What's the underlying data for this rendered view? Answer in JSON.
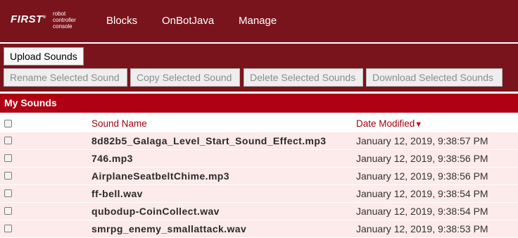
{
  "nav": {
    "logo_first": "FIRST",
    "logo_line1": "robot",
    "logo_line2": "controller",
    "logo_line3": "console",
    "items": [
      "Blocks",
      "OnBotJava",
      "Manage"
    ]
  },
  "actions": {
    "upload": "Upload Sounds",
    "rename": "Rename Selected Sound",
    "copy": "Copy Selected Sound",
    "delete": "Delete Selected Sounds",
    "download": "Download Selected Sounds"
  },
  "section_title": "My Sounds",
  "table": {
    "headers": {
      "name": "Sound Name",
      "date": "Date Modified",
      "sort_indicator": "▼"
    },
    "rows": [
      {
        "name": "8d82b5_Galaga_Level_Start_Sound_Effect.mp3",
        "date": "January 12, 2019, 9:38:57 PM"
      },
      {
        "name": "746.mp3",
        "date": "January 12, 2019, 9:38:56 PM"
      },
      {
        "name": "AirplaneSeatbeltChime.mp3",
        "date": "January 12, 2019, 9:38:56 PM"
      },
      {
        "name": "ff-bell.wav",
        "date": "January 12, 2019, 9:38:54 PM"
      },
      {
        "name": "qubodup-CoinCollect.wav",
        "date": "January 12, 2019, 9:38:54 PM"
      },
      {
        "name": "smrpg_enemy_smallattack.wav",
        "date": "January 12, 2019, 9:38:53 PM"
      }
    ]
  },
  "colors": {
    "navbar": "#7a141c",
    "section": "#b00014",
    "row_bg": "#fdeaea"
  }
}
